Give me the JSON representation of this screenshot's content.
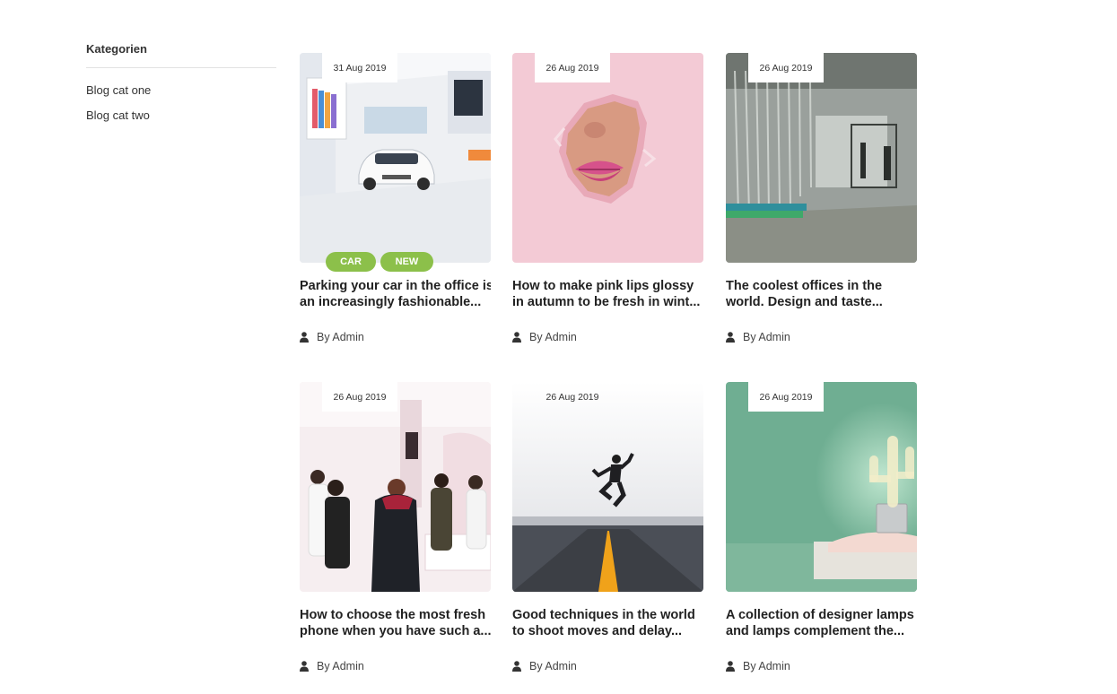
{
  "sidebar": {
    "title": "Kategorien",
    "items": [
      {
        "label": "Blog cat one"
      },
      {
        "label": "Blog cat two"
      }
    ]
  },
  "author_prefix": "By Admin",
  "posts": [
    {
      "date": "31 Aug 2019",
      "title_line1": "Parking your car in the office is",
      "title_line2": "an increasingly fashionable...",
      "author": "By Admin",
      "tags": [
        "CAR",
        "NEW"
      ],
      "image": "car-showroom"
    },
    {
      "date": "26 Aug 2019",
      "title_line1": "How to make pink lips glossy",
      "title_line2": "in autumn to be fresh in wint...",
      "author": "By Admin",
      "tags": [],
      "image": "pink-lips"
    },
    {
      "date": "26 Aug 2019",
      "title_line1": "The coolest offices in the",
      "title_line2": "world. Design and taste...",
      "author": "By Admin",
      "tags": [],
      "image": "office-interior"
    },
    {
      "date": "26 Aug 2019",
      "title_line1": "How to choose the most fresh",
      "title_line2": "phone when you have such a...",
      "author": "By Admin",
      "tags": [],
      "image": "phone-store"
    },
    {
      "date": "26 Aug 2019",
      "title_line1": "Good techniques in the world",
      "title_line2": "to shoot moves and delay...",
      "author": "By Admin",
      "tags": [],
      "image": "jumping-man-road"
    },
    {
      "date": "26 Aug 2019",
      "title_line1": "A collection of designer lamps",
      "title_line2": "and lamps complement the...",
      "author": "By Admin",
      "tags": [],
      "image": "cactus-lamp"
    }
  ],
  "colors": {
    "tag_green": "#8cc04a",
    "text_dark": "#222222",
    "divider": "#e2e2e2"
  }
}
